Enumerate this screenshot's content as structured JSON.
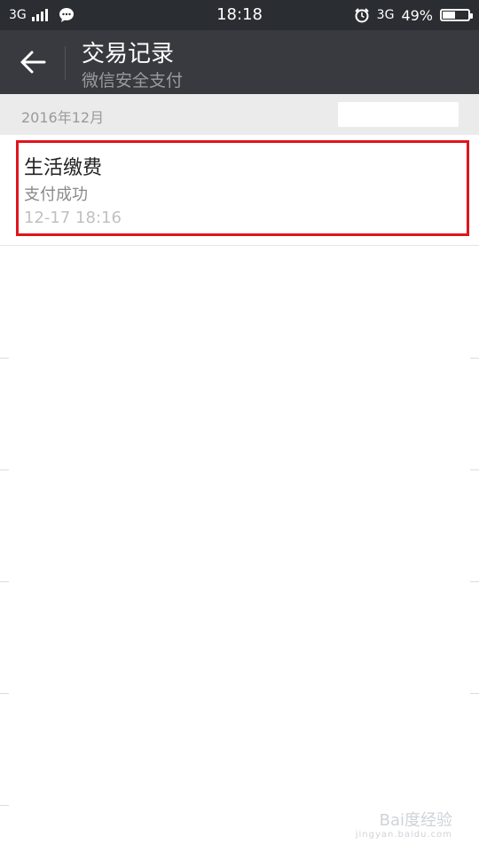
{
  "statusbar": {
    "network_left": "3G",
    "time": "18:18",
    "network_right": "3G",
    "battery": "49%",
    "battery_fraction": 0.49
  },
  "header": {
    "title": "交易记录",
    "subtitle": "微信安全支付"
  },
  "section": {
    "date": "2016年12月"
  },
  "records": [
    {
      "name": "生活缴费",
      "status": "支付成功",
      "time": "12-17 18:16"
    }
  ],
  "watermark": {
    "brand": "Bai度经验",
    "url": "jingyan.baidu.com"
  },
  "colors": {
    "titlebar": "#393a3f",
    "statusbar": "#2a2d31",
    "highlight": "#e0141e"
  }
}
